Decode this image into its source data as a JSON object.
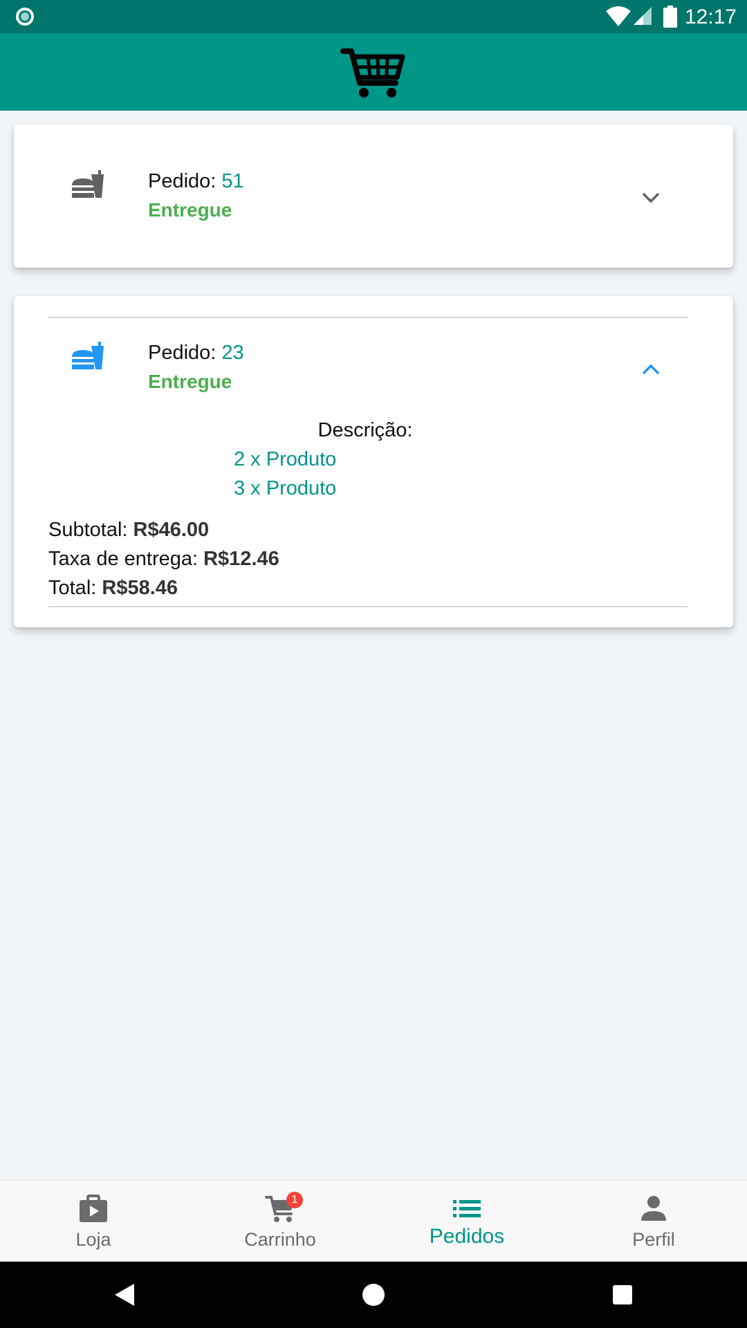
{
  "status_bar": {
    "time": "12:17"
  },
  "app_bar": {
    "icon": "cart-icon"
  },
  "orders": [
    {
      "label": "Pedido:",
      "number": "51",
      "status": "Entregue",
      "expanded": false,
      "icon_color": "#616161"
    },
    {
      "label": "Pedido:",
      "number": "23",
      "status": "Entregue",
      "expanded": true,
      "icon_color": "#2196f3",
      "description_title": "Descrição:",
      "items": [
        "2 x Produto",
        "3 x Produto"
      ],
      "subtotal_label": "Subtotal:",
      "subtotal_value": "R$46.00",
      "fee_label": "Taxa de entrega:",
      "fee_value": "R$12.46",
      "total_label": "Total:",
      "total_value": "R$58.46"
    }
  ],
  "bottom_nav": [
    {
      "label": "Loja",
      "icon": "store-icon"
    },
    {
      "label": "Carrinho",
      "icon": "cart-icon",
      "badge": "1"
    },
    {
      "label": "Pedidos",
      "icon": "list-icon",
      "active": true
    },
    {
      "label": "Perfil",
      "icon": "person-icon"
    }
  ],
  "colors": {
    "status_bar": "#00756b",
    "app_bar": "#009688",
    "accent": "#009688",
    "delivered": "#4caf50",
    "badge": "#f44336",
    "background": "#f1f5f8"
  }
}
